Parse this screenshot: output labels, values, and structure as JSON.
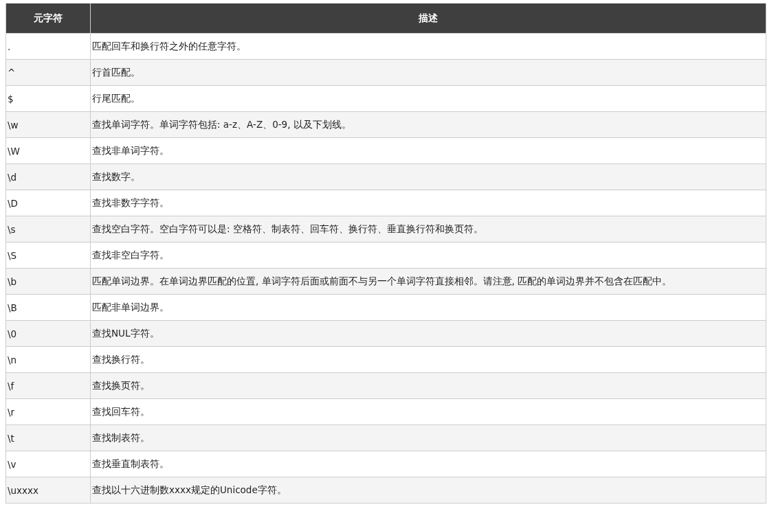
{
  "table": {
    "columns": [
      "元字符",
      "描述"
    ],
    "rows": [
      {
        "symbol": ".",
        "description": "匹配回车和换行符之外的任意字符。"
      },
      {
        "symbol": "^",
        "description": "行首匹配。"
      },
      {
        "symbol": "$",
        "description": "行尾匹配。"
      },
      {
        "symbol": "\\w",
        "description": "查找单词字符。单词字符包括: a-z、A-Z、0-9, 以及下划线。"
      },
      {
        "symbol": "\\W",
        "description": "查找非单词字符。"
      },
      {
        "symbol": "\\d",
        "description": "查找数字。"
      },
      {
        "symbol": "\\D",
        "description": "查找非数字字符。"
      },
      {
        "symbol": "\\s",
        "description": "查找空白字符。空白字符可以是: 空格符、制表符、回车符、换行符、垂直换行符和换页符。"
      },
      {
        "symbol": "\\S",
        "description": "查找非空白字符。"
      },
      {
        "symbol": "\\b",
        "description": "匹配单词边界。在单词边界匹配的位置, 单词字符后面或前面不与另一个单词字符直接相邻。请注意, 匹配的单词边界并不包含在匹配中。"
      },
      {
        "symbol": "\\B",
        "description": "匹配非单词边界。"
      },
      {
        "symbol": "\\0",
        "description": "查找NUL字符。"
      },
      {
        "symbol": "\\n",
        "description": "查找换行符。"
      },
      {
        "symbol": "\\f",
        "description": "查找换页符。"
      },
      {
        "symbol": "\\r",
        "description": "查找回车符。"
      },
      {
        "symbol": "\\t",
        "description": "查找制表符。"
      },
      {
        "symbol": "\\v",
        "description": "查找垂直制表符。"
      },
      {
        "symbol": "\\uxxxx",
        "description": "查找以十六进制数xxxx规定的Unicode字符。"
      }
    ]
  }
}
